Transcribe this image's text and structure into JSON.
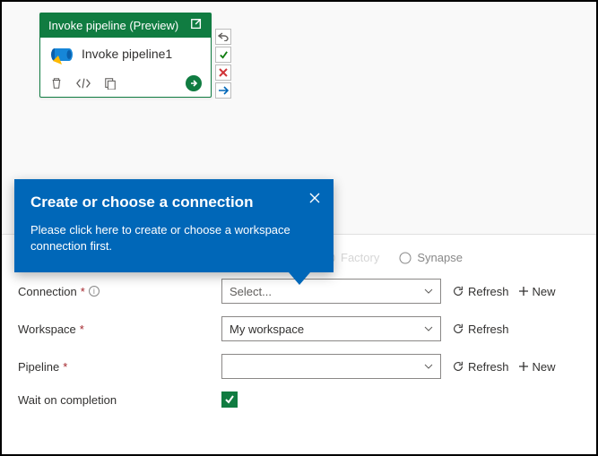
{
  "activity": {
    "type_label": "Invoke pipeline (Preview)",
    "name": "Invoke pipeline1"
  },
  "callout": {
    "title": "Create or choose a connection",
    "body": "Please click here to create or choose a workspace connection first."
  },
  "radios": {
    "factory": "Factory",
    "synapse": "Synapse"
  },
  "form": {
    "connection_label": "Connection",
    "connection_value": "Select...",
    "workspace_label": "Workspace",
    "workspace_value": "My workspace",
    "pipeline_label": "Pipeline",
    "pipeline_value": "",
    "wait_label": "Wait on completion",
    "refresh": "Refresh",
    "new": "New"
  }
}
